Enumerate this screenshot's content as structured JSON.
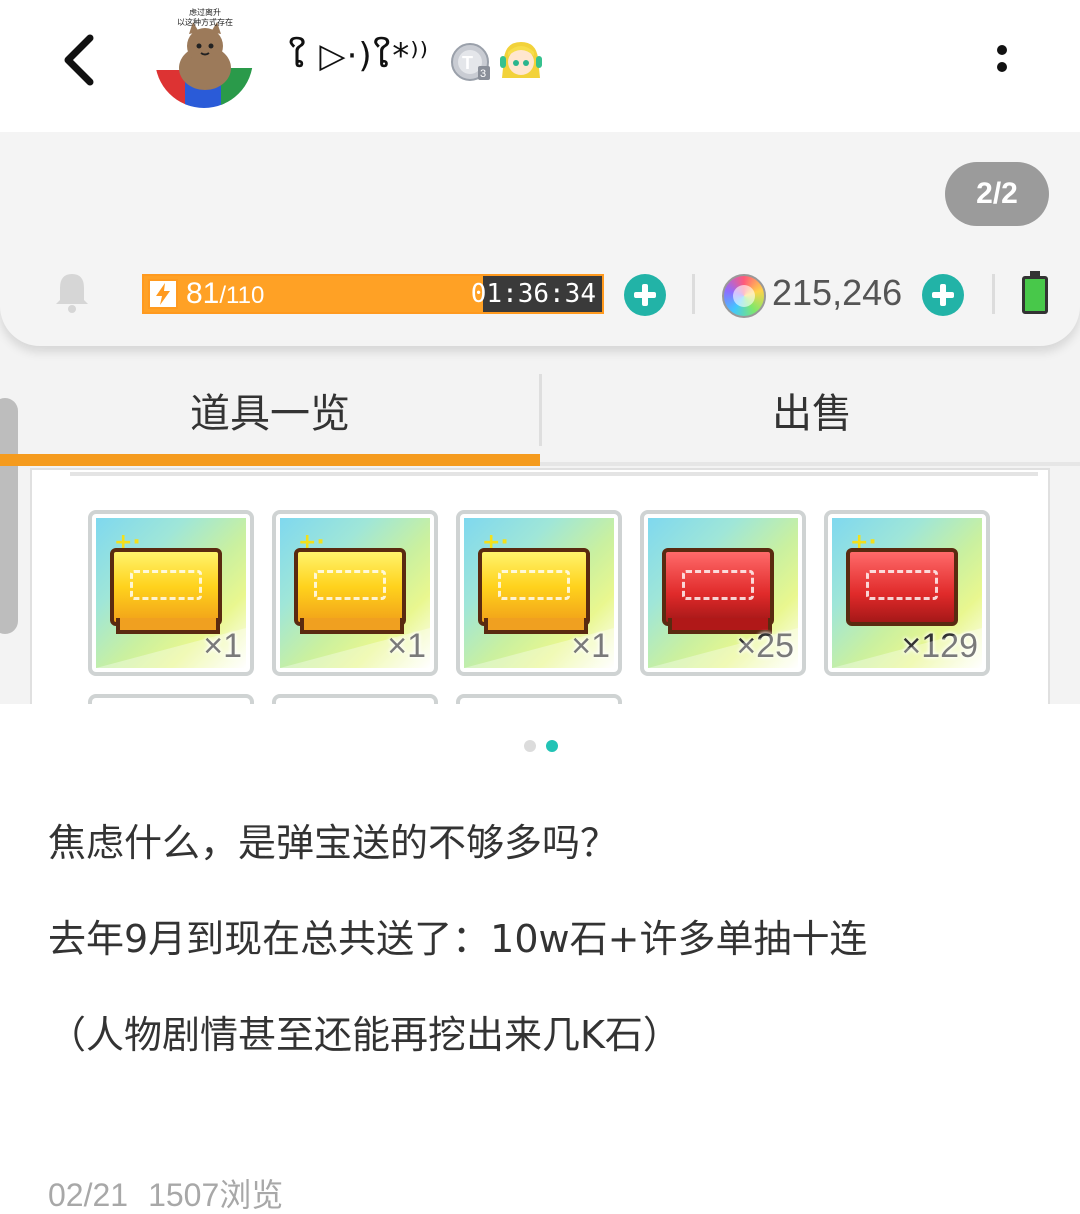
{
  "header": {
    "back_icon": "chevron-left-icon",
    "avatar_caption_line1": "虑过离升",
    "avatar_caption_line2": "以这种方式存在",
    "username": "ໃ ▷·)ໃ*⁾⁾",
    "badge_t3_label": "T3",
    "more_icon": "vertical-dots-icon"
  },
  "screenshot": {
    "page_counter": "2/2",
    "bell_icon": "bell-icon",
    "stamina": {
      "current": "81",
      "max": "/110",
      "fraction": 0.74,
      "timer": "01:36:34"
    },
    "gem_count": "215,246",
    "battery_icon": "battery-icon",
    "tabs": [
      {
        "label": "道具一览",
        "active": true
      },
      {
        "label": "出售",
        "active": false
      }
    ],
    "items": [
      {
        "type": "gold-ticket",
        "quantity": "×1"
      },
      {
        "type": "gold-ticket",
        "quantity": "×1"
      },
      {
        "type": "gold-ticket",
        "quantity": "×1"
      },
      {
        "type": "red-ticket",
        "quantity": "×25"
      },
      {
        "type": "red-ticket",
        "quantity": "×129"
      }
    ],
    "colors": {
      "accent": "#f59b1e",
      "teal": "#22b3a7",
      "battery": "#48c84a"
    }
  },
  "pager": {
    "total": 2,
    "active": 2
  },
  "post": {
    "lines": [
      "焦虑什么，是弹宝送的不够多吗？",
      "去年9月到现在总共送了：10w石+许多单抽十连",
      "（人物剧情甚至还能再挖出来几K石）"
    ],
    "date": "02/21",
    "views": "1507浏览"
  }
}
